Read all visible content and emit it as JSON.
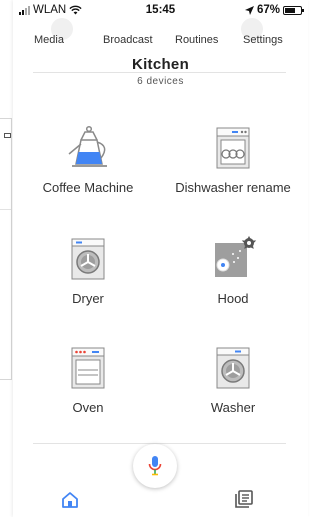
{
  "status_bar": {
    "carrier": "WLAN",
    "time": "15:45",
    "battery": "67%",
    "battery_level": 0.67
  },
  "top_nav": {
    "items": [
      "Media",
      "Broadcast",
      "Routines",
      "Settings"
    ]
  },
  "room": {
    "title": "Kitchen",
    "subtitle": "6 devices"
  },
  "devices": [
    {
      "label": "Coffee Machine",
      "icon": "kettle-icon"
    },
    {
      "label": "Dishwasher rename",
      "icon": "dishwasher-icon"
    },
    {
      "label": "Dryer",
      "icon": "dryer-icon"
    },
    {
      "label": "Hood",
      "icon": "hood-icon"
    },
    {
      "label": "Oven",
      "icon": "oven-icon"
    },
    {
      "label": "Washer",
      "icon": "washer-icon"
    }
  ],
  "bottom_bar": {
    "left_icon": "home-icon",
    "center_icon": "mic-icon",
    "right_icon": "media-icon"
  },
  "colors": {
    "accent_blue": "#4285F4",
    "mic_red": "#EA4335",
    "mic_yellow": "#FBBC05",
    "mic_green": "#34A853",
    "appliance_gray": "#7f7f7f"
  }
}
